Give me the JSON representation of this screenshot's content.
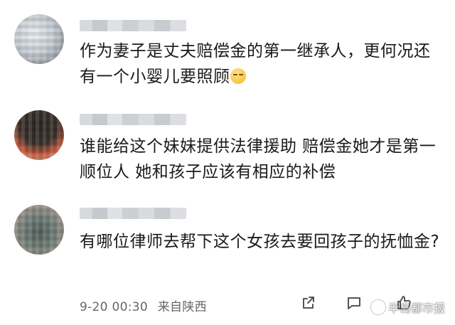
{
  "comments": [
    {
      "username": "",
      "text": "作为妻子是丈夫赔偿金的第一继承人，更何况还有一个小婴儿要照顾",
      "emoji": "smirk-emoji"
    },
    {
      "username": "",
      "text": "谁能给这个妹妹提供法律援助 赔偿金她才是第一顺位人 她和孩子应该有相应的补偿"
    },
    {
      "username": "",
      "text": "有哪位律师去帮下这个女孩去要回孩子的抚恤金?"
    }
  ],
  "meta": {
    "time": "9-20 00:30",
    "location": "来自陕西"
  },
  "icons": {
    "share": "share-icon",
    "comment": "comment-icon",
    "like": "like-icon"
  },
  "watermark": "半岛都市报"
}
